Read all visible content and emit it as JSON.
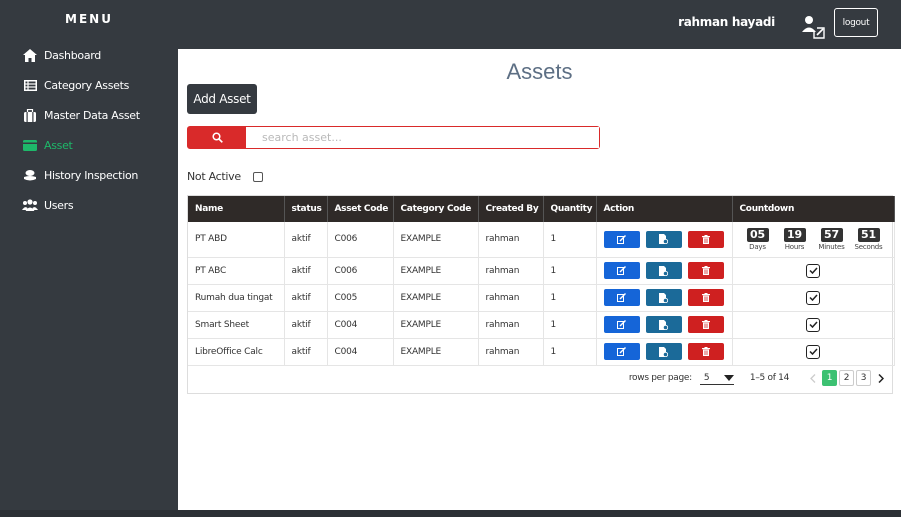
{
  "sidebar": {
    "title": "MENU",
    "items": [
      {
        "label": "Dashboard",
        "icon": "home-icon"
      },
      {
        "label": "Category Assets",
        "icon": "list-icon"
      },
      {
        "label": "Master Data Asset",
        "icon": "briefcase-icon"
      },
      {
        "label": "Asset",
        "icon": "card-icon",
        "active": true
      },
      {
        "label": "History Inspection",
        "icon": "history-icon"
      },
      {
        "label": "Users",
        "icon": "users-icon"
      }
    ]
  },
  "header": {
    "username": "rahman hayadi",
    "logout_label": "logout"
  },
  "main": {
    "title": "Assets",
    "add_button": "Add Asset",
    "search_placeholder": "search asset...",
    "not_active_label": "Not Active"
  },
  "table": {
    "columns": [
      "Name",
      "status",
      "Asset Code",
      "Category Code",
      "Created By",
      "Quantity",
      "Action",
      "Countdown"
    ],
    "rows": [
      {
        "name": "PT ABD",
        "status": "aktif",
        "asset_code": "C006",
        "category_code": "EXAMPLE",
        "created_by": "rahman",
        "quantity": "1"
      },
      {
        "name": "PT ABC",
        "status": "aktif",
        "asset_code": "C006",
        "category_code": "EXAMPLE",
        "created_by": "rahman",
        "quantity": "1"
      },
      {
        "name": "Rumah dua tingat",
        "status": "aktif",
        "asset_code": "C005",
        "category_code": "EXAMPLE",
        "created_by": "rahman",
        "quantity": "1"
      },
      {
        "name": "Smart Sheet",
        "status": "aktif",
        "asset_code": "C004",
        "category_code": "EXAMPLE",
        "created_by": "rahman",
        "quantity": "1"
      },
      {
        "name": "LibreOffice Calc",
        "status": "aktif",
        "asset_code": "C004",
        "category_code": "EXAMPLE",
        "created_by": "rahman",
        "quantity": "1"
      }
    ],
    "countdown": [
      {
        "value": "05",
        "label": "Days"
      },
      {
        "value": "19",
        "label": "Hours"
      },
      {
        "value": "57",
        "label": "Minutes"
      },
      {
        "value": "51",
        "label": "Seconds"
      }
    ]
  },
  "pagination": {
    "rows_per_page_label": "rows per page:",
    "rows_per_page_value": "5",
    "range": "1–5 of 14",
    "pages": [
      "1",
      "2",
      "3"
    ],
    "current_page": "1"
  },
  "colors": {
    "sidebar_bg": "#353a40",
    "active": "#1eb86a",
    "edit": "#1565d8",
    "detail": "#1b6a99",
    "delete": "#cf2020",
    "search_border": "#d92a2a",
    "table_header": "#2f2a28",
    "page_active": "#3cc172"
  }
}
